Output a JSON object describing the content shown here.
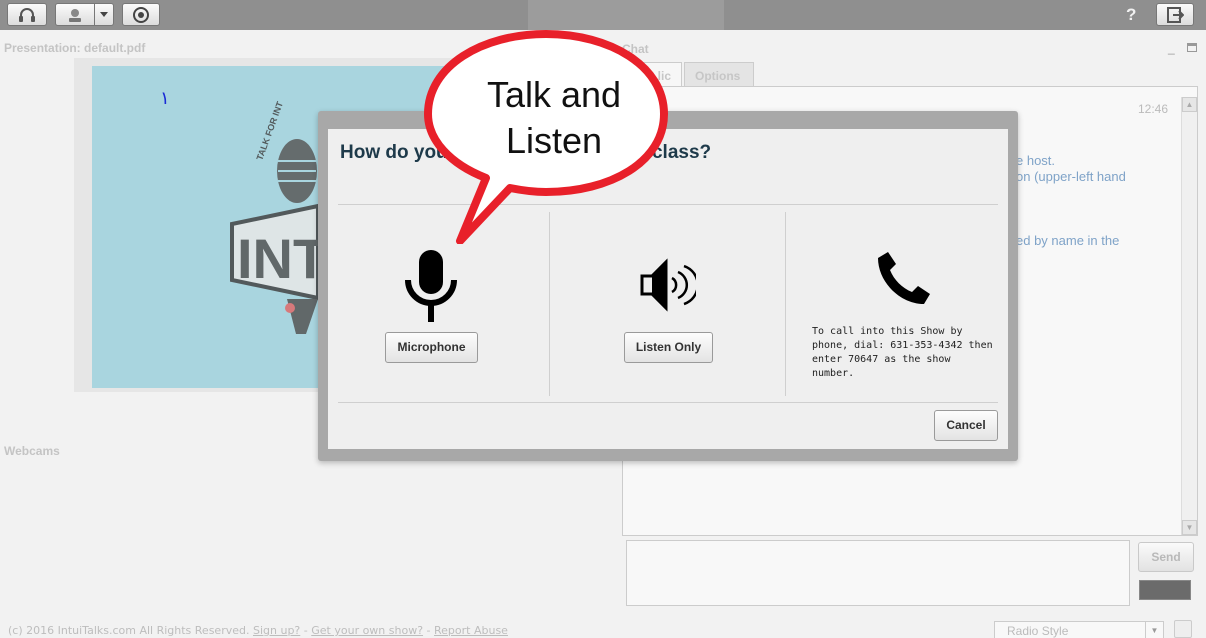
{
  "toolbar": {
    "buttons": [
      "headset-icon",
      "webcam-icon",
      "dropdown-arrow-icon",
      "record-icon"
    ],
    "help_label": "?",
    "logout_icon": "logout-icon"
  },
  "presentation": {
    "title": "Presentation: default.pdf",
    "slide_number": "١",
    "slide_logo_text": "INTUI",
    "slide_logo_arc": "TALK FOR INT"
  },
  "webcams": {
    "title": "Webcams"
  },
  "chat": {
    "title": "Chat",
    "tabs": [
      "lic",
      "Options"
    ],
    "time": "12:46",
    "lines": [
      "e host.",
      "on (upper-left hand",
      "ed by name in the"
    ],
    "send_label": "Send"
  },
  "footer": {
    "copyright": "(c) 2016 IntuiTalks.com All Rights Reserved.",
    "signup": "Sign up?",
    "sep": " - ",
    "get_show": "Get your own show?",
    "report": "Report Abuse",
    "style_select": "Radio Style"
  },
  "modal": {
    "title_left": "How do you",
    "title_right": "w or class?",
    "microphone_label": "Microphone",
    "listen_label": "Listen Only",
    "phone_text": "To call into this Show by phone, dial: 631-353-4342 then enter 70647 as the show number.",
    "cancel_label": "Cancel"
  },
  "bubble": {
    "line1": "Talk and",
    "line2": "Listen"
  },
  "colors": {
    "bubble_border": "#e8202a",
    "modal_title": "#1e3a4a",
    "slide_bg": "#a9d5df"
  }
}
